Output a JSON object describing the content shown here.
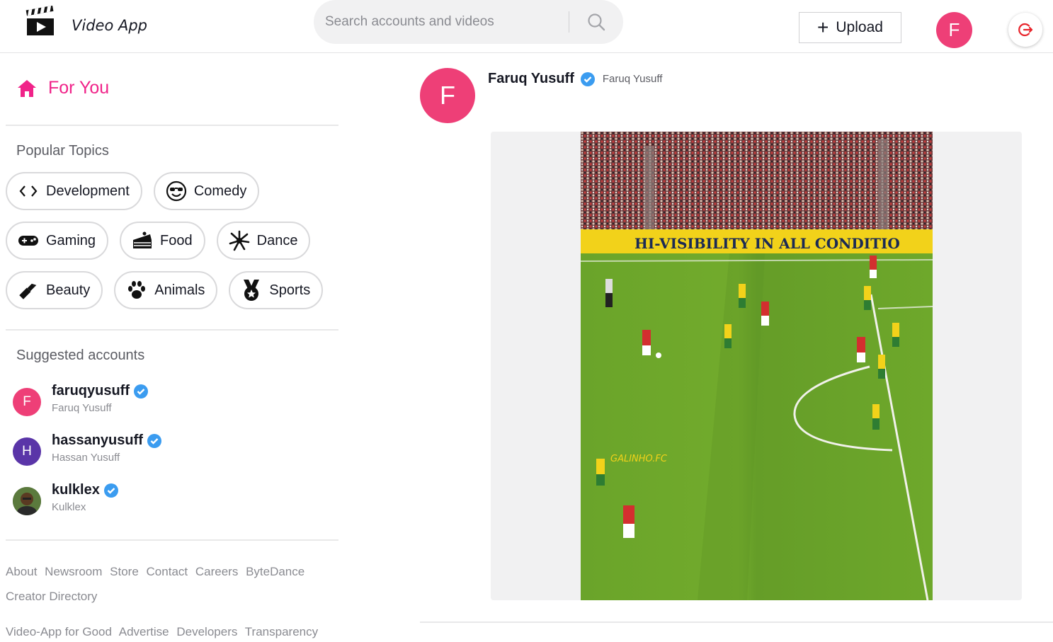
{
  "header": {
    "app_name": "Video App",
    "search_placeholder": "Search accounts and videos",
    "upload_label": "Upload",
    "user_initial": "F"
  },
  "sidebar": {
    "for_you_label": "For You",
    "popular_topics_title": "Popular Topics",
    "topics": [
      {
        "label": "Development",
        "icon": "code-icon"
      },
      {
        "label": "Comedy",
        "icon": "sunglasses-face-icon"
      },
      {
        "label": "Gaming",
        "icon": "gamepad-icon"
      },
      {
        "label": "Food",
        "icon": "cake-slice-icon"
      },
      {
        "label": "Dance",
        "icon": "dance-icon"
      },
      {
        "label": "Beauty",
        "icon": "lipstick-icon"
      },
      {
        "label": "Animals",
        "icon": "paw-icon"
      },
      {
        "label": "Sports",
        "icon": "medal-icon"
      }
    ],
    "suggested_title": "Suggested accounts",
    "accounts": [
      {
        "username": "faruqyusuff",
        "display_name": "Faruq Yusuff",
        "initial": "F",
        "color": "#ee3f77"
      },
      {
        "username": "hassanyusuff",
        "display_name": "Hassan Yusuff",
        "initial": "H",
        "color": "#5a35a8"
      },
      {
        "username": "kulklex",
        "display_name": "Kulklex",
        "initial": "",
        "color": "#4a6b3a"
      }
    ],
    "footer_line1": [
      "About",
      "Newsroom",
      "Store",
      "Contact",
      "Careers",
      "ByteDance"
    ],
    "footer_line2": [
      "Creator Directory"
    ],
    "footer_line3": [
      "Video-App for Good",
      "Advertise",
      "Developers",
      "Transparency"
    ]
  },
  "post": {
    "author_initial": "F",
    "author_name": "Faruq Yusuff",
    "author_display": "Faruq Yusuff",
    "video_banner_text": "HI-VISIBILITY IN ALL CONDITIO",
    "video_watermark": "GALINHO.FC"
  },
  "colors": {
    "accent": "#f02389",
    "avatar_pink": "#ee3f77",
    "verified_blue": "#20d5ec"
  }
}
